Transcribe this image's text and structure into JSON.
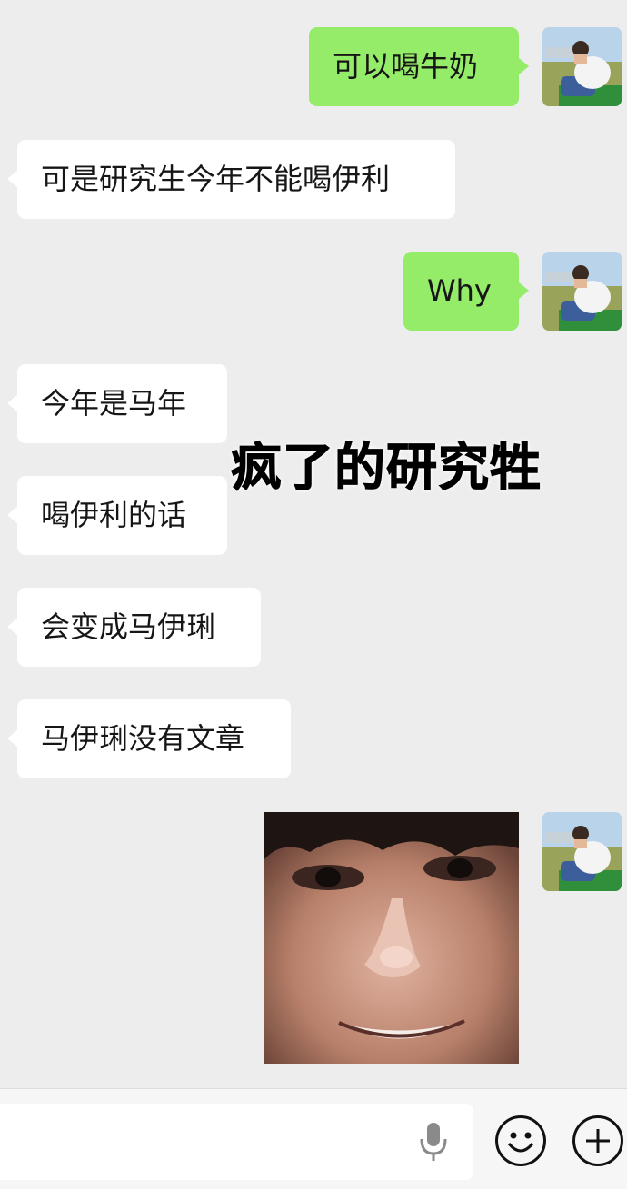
{
  "messages": [
    {
      "side": "me",
      "text": "可以喝牛奶"
    },
    {
      "side": "them",
      "text": "可是研究生今年不能喝伊利"
    },
    {
      "side": "me",
      "text": "Why"
    },
    {
      "side": "them",
      "text": "今年是马年"
    },
    {
      "side": "them",
      "text": "喝伊利的话"
    },
    {
      "side": "them",
      "text": "会变成马伊琍"
    },
    {
      "side": "them",
      "text": "马伊琍没有文章"
    }
  ],
  "overlay_caption": "疯了的研究牲",
  "sticker": {
    "icon": "selfie-face-sticker"
  },
  "input": {
    "value": "",
    "placeholder": ""
  },
  "icons": {
    "mic": "microphone-icon",
    "emoji": "smiley-face-icon",
    "plus": "plus-circle-icon"
  },
  "colors": {
    "background": "#ededed",
    "my_bubble": "#95ec69",
    "their_bubble": "#ffffff"
  }
}
